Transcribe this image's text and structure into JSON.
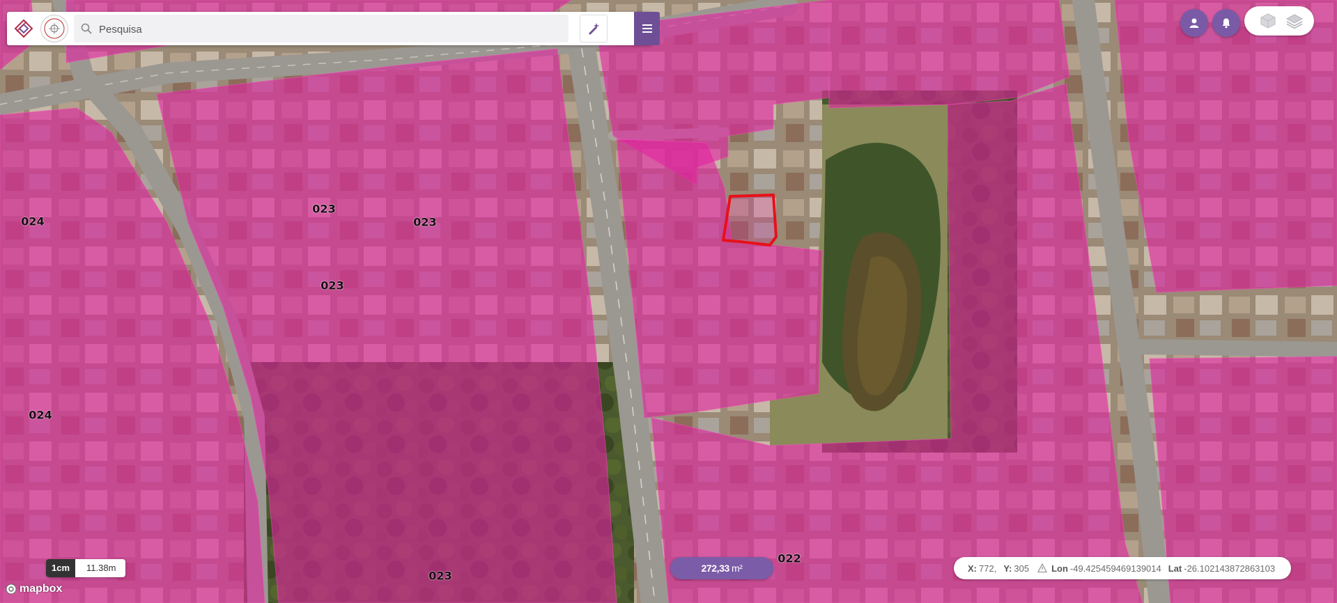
{
  "search": {
    "placeholder": "Pesquisa"
  },
  "zone_labels": [
    {
      "id": "024-a",
      "text": "024"
    },
    {
      "id": "023-a",
      "text": "023"
    },
    {
      "id": "023-b",
      "text": "023"
    },
    {
      "id": "023-c",
      "text": "023"
    },
    {
      "id": "024-b",
      "text": "024"
    },
    {
      "id": "023-d",
      "text": "023"
    },
    {
      "id": "022-a",
      "text": "022"
    }
  ],
  "scale": {
    "unit": "1cm",
    "distance": "11.38m"
  },
  "attribution": {
    "logo_text": "mapbox"
  },
  "measurement": {
    "value": "272,33",
    "unit": "m²"
  },
  "cursor": {
    "x_label": "X:",
    "x_value": "772,",
    "y_label": "Y:",
    "y_value": "305",
    "lon_label": "Lon",
    "lon_value": "-49.425459469139014",
    "lat_label": "Lat",
    "lat_value": "-26.102143872863103"
  },
  "icons": {
    "tool": "drawing-tool-icon",
    "menu": "hamburger-menu-icon",
    "user": "user-icon",
    "notifications": "bell-icon",
    "layer_3d": "cube-layer-icon",
    "layers": "layers-stack-icon",
    "search": "search-icon",
    "warning": "warning-icon"
  },
  "colors": {
    "overlay": "#e0239f",
    "accent": "#7b5ca8",
    "selection": "#e8101a"
  }
}
